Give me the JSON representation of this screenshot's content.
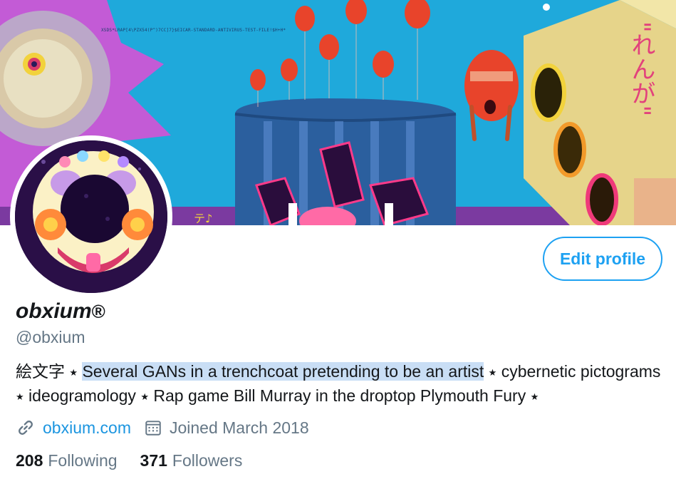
{
  "colors": {
    "accent": "#1da1f2",
    "link": "#1b95e0",
    "muted": "#657786",
    "text": "#14171a",
    "highlight": "#c9def5"
  },
  "banner": {
    "scrolling_text": "XSDS*LRAP[4\\PZX54(P^)7CC]7}$EICAR-STANDARD-ANTIVIRUS-TEST-FILE!$H+H*",
    "vertical_text": "\"れんが\""
  },
  "profile": {
    "display_name": "obxium",
    "name_suffix": "®",
    "handle": "@obxium",
    "edit_button_label": "Edit profile",
    "bio": {
      "part_kanji": "絵文字",
      "star": "★",
      "part_highlighted": "Several GANs in a trenchcoat pretending to be an artist",
      "part_cyber": "cybernetic",
      "part_pictograms": "pictograms",
      "part_ideogram": "ideogramology",
      "part_rap": "Rap game Bill Murray in the droptop Plymouth Fury"
    },
    "website": "obxium.com",
    "joined": "Joined March 2018",
    "following_count": "208",
    "following_label": "Following",
    "followers_count": "371",
    "followers_label": "Followers"
  },
  "icons": {
    "link": "link-icon",
    "calendar": "calendar-icon"
  }
}
